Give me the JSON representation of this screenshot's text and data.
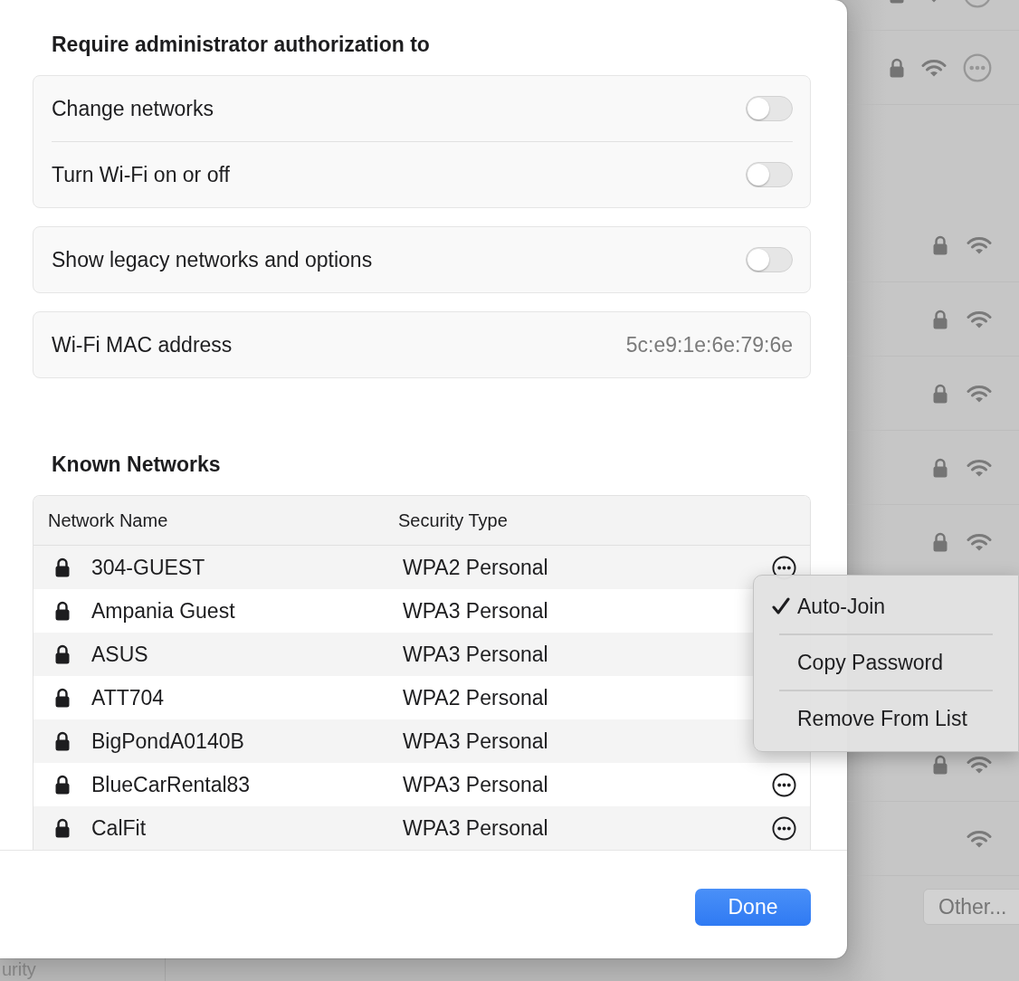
{
  "dialog": {
    "section_title": "Require administrator authorization to",
    "auth_settings": [
      {
        "label": "Change networks",
        "on": false
      },
      {
        "label": "Turn Wi-Fi on or off",
        "on": false
      }
    ],
    "legacy_setting": {
      "label": "Show legacy networks and options",
      "on": false
    },
    "mac_address": {
      "label": "Wi-Fi MAC address",
      "value": "5c:e9:1e:6e:79:6e"
    },
    "known_networks": {
      "title": "Known Networks",
      "columns": [
        "Network Name",
        "Security Type"
      ],
      "rows": [
        {
          "name": "304-GUEST",
          "security": "WPA2 Personal",
          "more_button": true
        },
        {
          "name": "Ampania Guest",
          "security": "WPA3 Personal",
          "more_button": false
        },
        {
          "name": "ASUS",
          "security": "WPA3 Personal",
          "more_button": false
        },
        {
          "name": "ATT704",
          "security": "WPA2 Personal",
          "more_button": false
        },
        {
          "name": "BigPondA0140B",
          "security": "WPA3 Personal",
          "more_button": false
        },
        {
          "name": "BlueCarRental83",
          "security": "WPA3 Personal",
          "more_button": true
        },
        {
          "name": "CalFit",
          "security": "WPA3 Personal",
          "more_button": true
        }
      ]
    },
    "done_button": "Done"
  },
  "context_menu": {
    "items": [
      {
        "label": "Auto-Join",
        "checked": true
      },
      {
        "label": "Copy Password",
        "checked": false
      },
      {
        "label": "Remove From List",
        "checked": false
      }
    ]
  },
  "background": {
    "groups": [
      [
        {
          "kind": "secured-with-options"
        },
        {
          "kind": "secured-with-options"
        }
      ],
      [
        {
          "kind": "secured"
        },
        {
          "kind": "secured"
        },
        {
          "kind": "secured"
        },
        {
          "kind": "secured"
        },
        {
          "kind": "secured"
        },
        {
          "kind": "hidden"
        },
        {
          "kind": "hidden"
        },
        {
          "kind": "secured"
        },
        {
          "kind": "open"
        }
      ]
    ],
    "other_button": "Other...",
    "sidebar_text": "urity"
  }
}
